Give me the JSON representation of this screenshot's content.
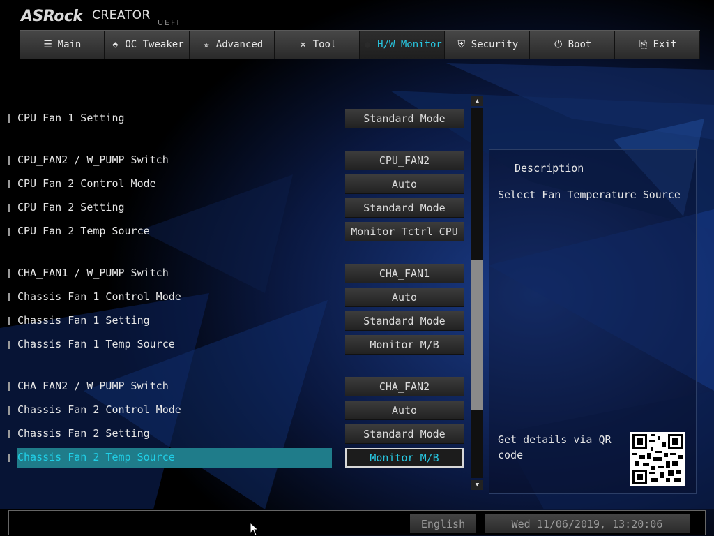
{
  "brand": {
    "logo": "ASRock",
    "edition": "CREATOR",
    "suffix": "UEFI"
  },
  "tabs": [
    {
      "label": "Main",
      "icon": "list-icon",
      "glyph": "☰",
      "active": false
    },
    {
      "label": "OC Tweaker",
      "icon": "rocket-icon",
      "glyph": "⬘",
      "active": false
    },
    {
      "label": "Advanced",
      "icon": "star-icon",
      "glyph": "✯",
      "active": false
    },
    {
      "label": "Tool",
      "icon": "tools-icon",
      "glyph": "✕",
      "active": false
    },
    {
      "label": "H/W Monitor",
      "icon": "monitor-icon",
      "glyph": "●",
      "active": true
    },
    {
      "label": "Security",
      "icon": "shield-icon",
      "glyph": "⛨",
      "active": false
    },
    {
      "label": "Boot",
      "icon": "power-icon",
      "glyph": "⏻",
      "active": false
    },
    {
      "label": "Exit",
      "icon": "exit-icon",
      "glyph": "⎘",
      "active": false
    }
  ],
  "settings": [
    {
      "label": "CPU Fan 1 Setting",
      "value": "Standard Mode"
    },
    {
      "label": "CPU_FAN2 / W_PUMP Switch",
      "value": "CPU_FAN2"
    },
    {
      "label": "CPU Fan 2 Control Mode",
      "value": "Auto"
    },
    {
      "label": "CPU Fan 2 Setting",
      "value": "Standard Mode"
    },
    {
      "label": "CPU Fan 2 Temp Source",
      "value": "Monitor Tctrl CPU"
    },
    {
      "label": "CHA_FAN1 / W_PUMP Switch",
      "value": "CHA_FAN1"
    },
    {
      "label": "Chassis Fan 1 Control Mode",
      "value": "Auto"
    },
    {
      "label": "Chassis Fan 1 Setting",
      "value": "Standard Mode"
    },
    {
      "label": "Chassis Fan 1 Temp Source",
      "value": "Monitor M/B"
    },
    {
      "label": "CHA_FAN2 / W_PUMP Switch",
      "value": "CHA_FAN2"
    },
    {
      "label": "Chassis Fan 2 Control Mode",
      "value": "Auto"
    },
    {
      "label": "Chassis Fan 2 Setting",
      "value": "Standard Mode"
    },
    {
      "label": "Chassis Fan 2 Temp Source",
      "value": "Monitor M/B",
      "selected": true
    }
  ],
  "description": {
    "title": "Description",
    "text": "Select Fan Temperature Source",
    "qr_text": "Get details via QR code"
  },
  "footer": {
    "language": "English",
    "datetime": "Wed 11/06/2019, 13:20:06"
  },
  "colors": {
    "accent": "#28c6e0",
    "selection": "#1f7c8a"
  }
}
